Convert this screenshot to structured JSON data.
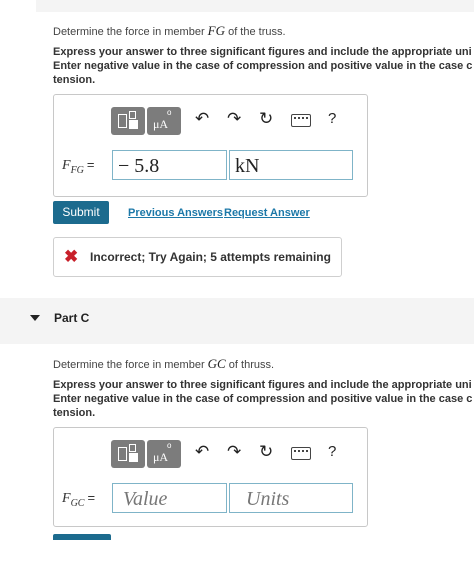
{
  "partB": {
    "question_prefix": "Determine the force in member ",
    "member": "FG",
    "question_suffix": " of the truss.",
    "instructions": [
      "Express your answer to three significant figures and include the appropriate uni",
      "Enter negative value in the case of compression and positive value in the case c",
      "tension."
    ],
    "variable": "F",
    "variable_sub": "FG",
    "equals": "=",
    "value": "− 5.8",
    "units": "kN",
    "submit_label": "Submit",
    "previous_answers_label": "Previous Answers",
    "request_answer_label": "Request Answer",
    "feedback_icon": "✖",
    "feedback": "Incorrect; Try Again; 5 attempts remaining"
  },
  "toolbar": {
    "mu_label": "μA",
    "ring_label": "o",
    "undo": "↶",
    "redo": "↷",
    "reset": "↻",
    "help": "?"
  },
  "partC": {
    "title": "Part C",
    "question_prefix": "Determine the force in member ",
    "member": "GC",
    "question_suffix": " of thruss.",
    "instructions": [
      "Express your answer to three significant figures and include the appropriate uni",
      "Enter negative value in the case of compression and positive value in the case c",
      "tension."
    ],
    "variable": "F",
    "variable_sub": "GC",
    "equals": "=",
    "value_placeholder": "Value",
    "units_placeholder": "Units"
  },
  "colors": {
    "accent": "#1c6b8e",
    "link": "#1c78a8",
    "error": "#c8202a",
    "toolbar_button": "#7c7c7c"
  }
}
